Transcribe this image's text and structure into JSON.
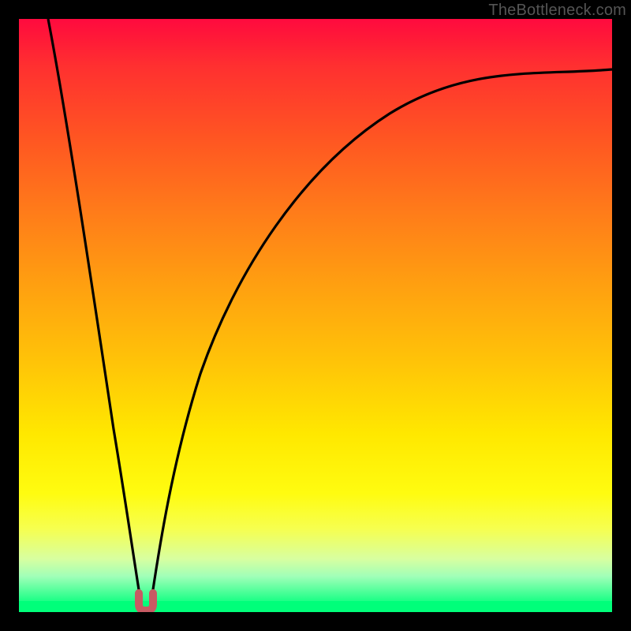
{
  "watermark": "TheBottleneck.com",
  "colors": {
    "frame": "#000000",
    "curve": "#000000",
    "marker": "#c75b63",
    "gradient_top": "#ff0a3f",
    "gradient_bottom": "#00ff7a"
  },
  "chart_data": {
    "type": "line",
    "title": "",
    "xlabel": "",
    "ylabel": "",
    "xlim": [
      0,
      100
    ],
    "ylim": [
      0,
      100
    ],
    "grid": false,
    "legend": false,
    "series": [
      {
        "name": "left-branch",
        "x": [
          5,
          7,
          9,
          11,
          13,
          15,
          17,
          18.5,
          19.5,
          20.3
        ],
        "y": [
          100,
          85,
          70,
          56,
          43,
          30,
          18,
          9,
          3.5,
          1.2
        ]
      },
      {
        "name": "right-branch",
        "x": [
          22.5,
          23.5,
          25,
          27,
          30,
          34,
          39,
          45,
          52,
          60,
          68,
          76,
          84,
          92,
          100
        ],
        "y": [
          1.2,
          3.5,
          8,
          15,
          25,
          36,
          47,
          57,
          66,
          73,
          79,
          83.5,
          87,
          89.5,
          91.5
        ]
      },
      {
        "name": "valley-marker",
        "x": [
          20.3,
          20.6,
          21.4,
          22.1,
          22.5
        ],
        "y": [
          1.2,
          0.3,
          0.0,
          0.3,
          1.2
        ]
      }
    ],
    "annotations": []
  }
}
